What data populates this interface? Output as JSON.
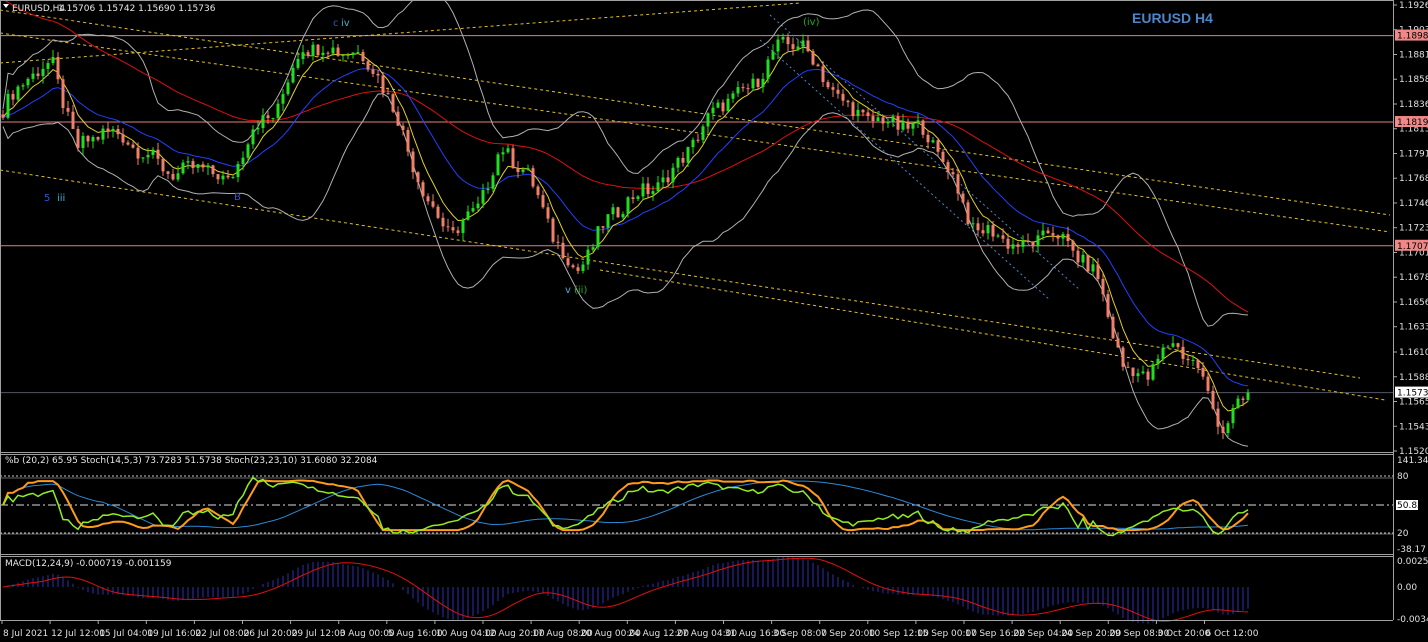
{
  "header": {
    "symbol_label": "EURUSD,H4",
    "ohlc": "1.15706 1.15742 1.15690 1.15736",
    "chart_title": "EURUSD H4"
  },
  "indicators": {
    "stoch_label": "%b (20,2) 65.95   Stoch(14,5,3) 73.7283 51.5738   Stoch(23,23,10) 31.6080 32.2084",
    "macd_label": "MACD(12,24,9) -0.000719 -0.001159",
    "stoch_axis": [
      "141.34",
      "80",
      "50.83",
      "20",
      "-38.17"
    ],
    "macd_axis": [
      "0.002527",
      "0.00",
      "-0.003406"
    ]
  },
  "wave_labels": {
    "c": "c",
    "iv": "iv",
    "iv_paren": "(iv)",
    "five": "5",
    "iii": "iii",
    "v": "v",
    "ii_paren": "(ii)",
    "b": "B"
  },
  "colors": {
    "background": "#000000",
    "bull_candle": "#22dd22",
    "bear_candle": "#f0806a",
    "level_line": "#e08080",
    "trendline": "#e0c020",
    "ma_fast": "#e0d020",
    "ma_mid": "#2040ff",
    "ma_slow": "#dd1010",
    "bands": "#b0b0b0",
    "title": "#4a86c8"
  },
  "chart_data": {
    "type": "candlestick",
    "symbol": "EURUSD",
    "timeframe": "H4",
    "ylim": [
      1.15205,
      1.1926
    ],
    "price_axis": [
      "1.19260",
      "1.19035",
      "1.18810",
      "1.18585",
      "1.18360",
      "1.18135",
      "1.17910",
      "1.17685",
      "1.17460",
      "1.17235",
      "1.17010",
      "1.16785",
      "1.16560",
      "1.16335",
      "1.16105",
      "1.15880",
      "1.15655",
      "1.15430",
      "1.15205"
    ],
    "levels": [
      {
        "price": 1.18982,
        "label": "1.18982"
      },
      {
        "price": 1.18196,
        "label": "1.18196"
      },
      {
        "price": 1.17071,
        "label": "1.17071"
      }
    ],
    "current_price": {
      "price": 1.15736,
      "label": "1.15736"
    },
    "time_axis": [
      "8 Jul 2021",
      "12 Jul 12:00",
      "15 Jul 04:00",
      "19 Jul 16:00",
      "22 Jul 08:00",
      "26 Jul 20:00",
      "29 Jul 12:00",
      "3 Aug 00:00",
      "5 Aug 16:00",
      "10 Aug 04:00",
      "12 Aug 20:00",
      "17 Aug 08:00",
      "20 Aug 00:00",
      "24 Aug 12:00",
      "27 Aug 04:00",
      "31 Aug 16:00",
      "3 Sep 08:00",
      "7 Sep 20:00",
      "10 Sep 12:00",
      "15 Sep 00:00",
      "17 Sep 16:00",
      "22 Sep 04:00",
      "24 Sep 20:00",
      "29 Sep 08:00",
      "3 Oct 20:00",
      "6 Oct 12:00"
    ],
    "close_path": [
      1.18305,
      1.18624,
      1.18715,
      1.17942,
      1.18124,
      1.18033,
      1.17851,
      1.17714,
      1.17805,
      1.17623,
      1.18124,
      1.18305,
      1.18896,
      1.18851,
      1.18851,
      1.18669,
      1.18124,
      1.17487,
      1.17169,
      1.17396,
      1.17942,
      1.1776,
      1.17214,
      1.16805,
      1.17214,
      1.17487,
      1.17578,
      1.1776,
      1.18124,
      1.18396,
      1.18487,
      1.18851,
      1.18942,
      1.18578,
      1.18305,
      1.18214,
      1.18169,
      1.18124,
      1.1776,
      1.17214,
      1.17169,
      1.17033,
      1.17214,
      1.17033,
      1.1676,
      1.15942,
      1.15896,
      1.16214,
      1.15942,
      1.15396,
      1.15736
    ]
  }
}
